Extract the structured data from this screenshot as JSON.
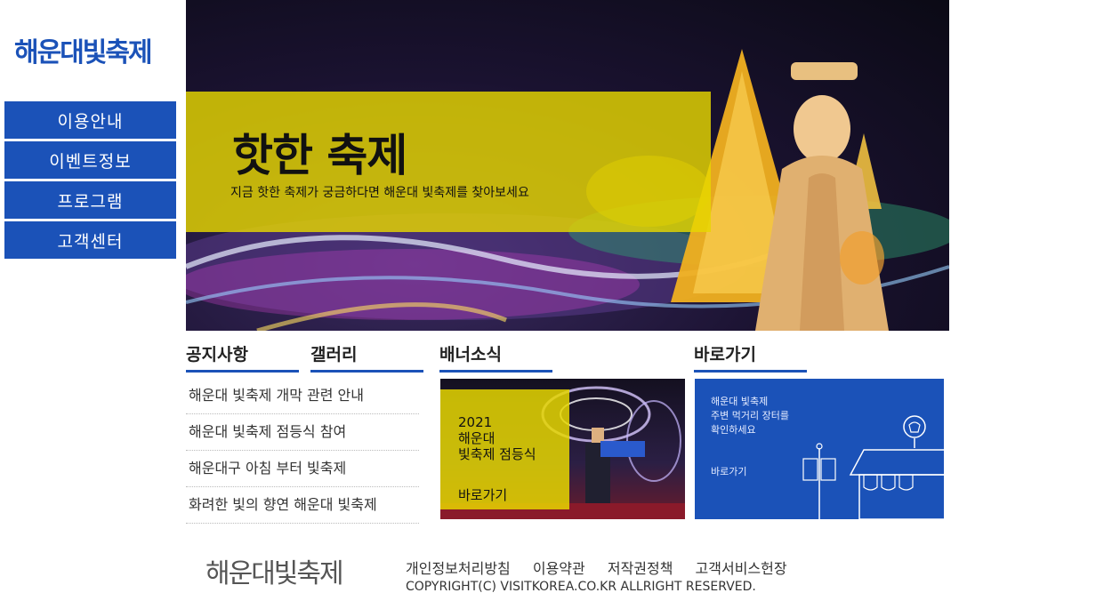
{
  "logo": "해운대빛축제",
  "nav": [
    "이용안내",
    "이벤트정보",
    "프로그램",
    "고객센터"
  ],
  "hero": {
    "title": "핫한 축제",
    "subtitle": "지금 핫한 축제가 궁금하다면 해운대 빛축제를 찾아보세요"
  },
  "tabs": {
    "notice": "공지사항",
    "gallery": "갤러리",
    "banner": "배너소식",
    "shortcut": "바로가기"
  },
  "notices": [
    "해운대 빛축제 개막 관련 안내",
    "해운대 빛축제 점등식 참여",
    "해운대구 아침 부터 빛축제",
    "화려한 빛의 향연 해운대 빛축제"
  ],
  "banner": {
    "title": "2021\n해운대\n빛축제 점등식",
    "link": "바로가기"
  },
  "shortcut": {
    "text": "해운대 빛축제\n주변 먹거리 장터를\n확인하세요",
    "link": "바로가기"
  },
  "footer": {
    "logo": "해운대빛축제",
    "links": [
      "개인정보처리방침",
      "이용약관",
      "저작권정책",
      "고객서비스헌장"
    ],
    "copyright": "COPYRIGHT(C) VISITKOREA.CO.KR ALLRIGHT RESERVED."
  },
  "colors": {
    "brand": "#1b52b8",
    "highlight": "#e6d700"
  }
}
